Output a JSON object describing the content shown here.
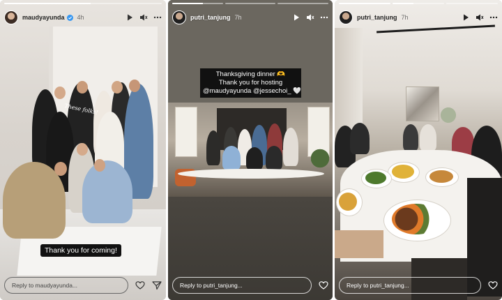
{
  "stories": [
    {
      "username": "maudyayunda",
      "verified": true,
      "timestamp": "4h",
      "segments": 1,
      "caption": "Thank you for coming!",
      "sign_text": "These folks!",
      "reply_placeholder": "Reply to maudyayunda...",
      "header_icons": [
        "play-icon",
        "mute-icon",
        "more-icon"
      ],
      "footer_icons": [
        "heart-icon",
        "send-icon"
      ]
    },
    {
      "username": "putri_tanjung",
      "verified": false,
      "timestamp": "7h",
      "segments": 3,
      "caption_lines": [
        "Thanksgiving dinner 🫶",
        "Thank you for hosting",
        "@maudyayunda @jessechoi_ 🤍"
      ],
      "reply_placeholder": "Reply to putri_tanjung...",
      "header_icons": [
        "play-icon",
        "mute-icon",
        "more-icon"
      ],
      "footer_icons": [
        "heart-icon"
      ]
    },
    {
      "username": "putri_tanjung",
      "verified": false,
      "timestamp": "7h",
      "segments": 3,
      "reply_placeholder": "Reply to putri_tanjung...",
      "header_icons": [
        "play-icon",
        "mute-icon",
        "more-icon"
      ],
      "footer_icons": [
        "heart-icon"
      ]
    }
  ],
  "colors": {
    "text_on_story": "#ffffff",
    "caption_bg": "#111111",
    "verified_blue": "#3897f0"
  }
}
